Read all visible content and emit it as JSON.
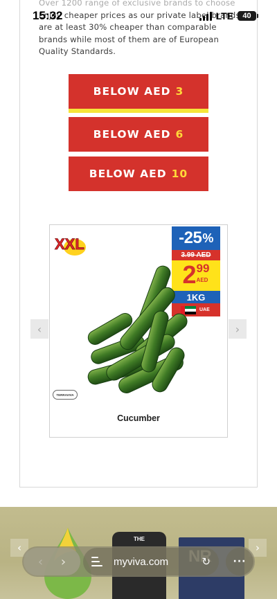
{
  "status_bar": {
    "time": "15:32",
    "network": "LTE",
    "battery": "40"
  },
  "intro": {
    "line_faded": "Over 1200 range of exclusive brands to choose",
    "text": "Enjoy cheaper prices as our private label brands are at least 30% cheaper than comparable brands while most of them are of European Quality Standards."
  },
  "price_buttons": [
    {
      "label": "BELOW AED",
      "amount": "3"
    },
    {
      "label": "BELOW AED",
      "amount": "6"
    },
    {
      "label": "BELOW AED",
      "amount": "10"
    }
  ],
  "product": {
    "badge": "XXL",
    "discount": "-25",
    "discount_sign": "%",
    "old_price": "3.99 AED",
    "price_int": "2",
    "price_dec": "99",
    "currency": "AED",
    "weight": "1KG",
    "origin": "UAE",
    "brand_mark": "TERRAVIVA",
    "name": "Cucumber"
  },
  "carousel": {
    "prev_icon": "‹",
    "next_icon": "›"
  },
  "brand_strip": {
    "brand_2_text": "THE",
    "brand_3_text": "NR"
  },
  "browser": {
    "url": "myviva.com",
    "back": "‹",
    "forward": "›",
    "reload": "↻",
    "more": "···"
  },
  "colors": {
    "accent_red": "#d4322c",
    "amount_yellow": "#ffd83a",
    "promo_blue": "#1e62b8"
  }
}
